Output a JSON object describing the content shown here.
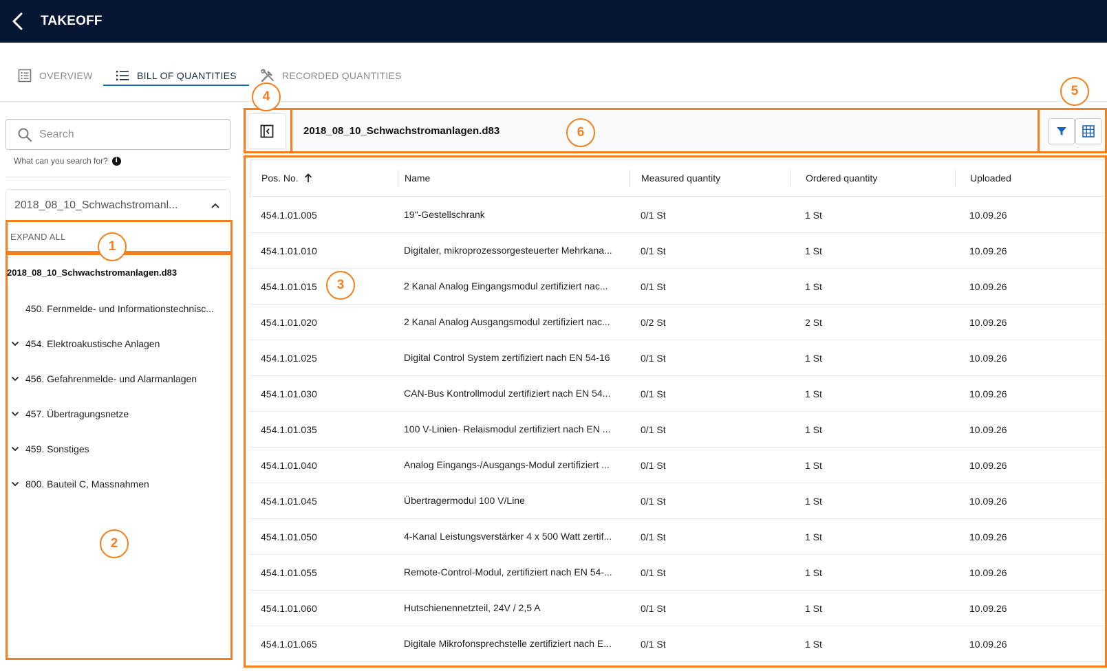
{
  "header": {
    "title": "TAKEOFF",
    "back_icon": "arrow-left-icon"
  },
  "tabs": [
    {
      "label": "OVERVIEW",
      "icon": "list-detail-icon",
      "active": false
    },
    {
      "label": "BILL OF QUANTITIES",
      "icon": "list-icon",
      "active": true
    },
    {
      "label": "RECORDED QUANTITIES",
      "icon": "tools-icon",
      "active": false
    }
  ],
  "sidebar": {
    "search_placeholder": "Search",
    "search_hint": "What can you search for?",
    "file_select": "2018_08_10_Schwachstromanl...",
    "expand_all": "EXPAND ALL",
    "tree_root": "2018_08_10_Schwachstromanlagen.d83",
    "tree_items": [
      {
        "label": "450. Fernmelde- und Informationstechnisc...",
        "expandable": false
      },
      {
        "label": "454. Elektroakustische Anlagen",
        "expandable": true
      },
      {
        "label": "456. Gefahrenmelde- und Alarmanlagen",
        "expandable": true
      },
      {
        "label": "457. Übertragungsnetze",
        "expandable": true
      },
      {
        "label": "459. Sonstiges",
        "expandable": true
      },
      {
        "label": "800. Bauteil C, Massnahmen",
        "expandable": true
      }
    ]
  },
  "toolbar": {
    "file_title": "2018_08_10_Schwachstromanlagen.d83"
  },
  "table": {
    "columns": [
      "Pos. No.",
      "Name",
      "Measured quantity",
      "Ordered quantity",
      "Uploaded"
    ],
    "sort_icon": "arrow-up-icon",
    "rows": [
      [
        "454.1.01.005",
        "19\"-Gestellschrank",
        "0/1 St",
        "1 St",
        "10.09.26"
      ],
      [
        "454.1.01.010",
        "Digitaler, mikroprozessorgesteuerter Mehrkana...",
        "0/1 St",
        "1 St",
        "10.09.26"
      ],
      [
        "454.1.01.015",
        "2 Kanal Analog Eingangsmodul zertifiziert nac...",
        "0/1 St",
        "1 St",
        "10.09.26"
      ],
      [
        "454.1.01.020",
        "2 Kanal Analog Ausgangsmodul zertifiziert nac...",
        "0/2 St",
        "2 St",
        "10.09.26"
      ],
      [
        "454.1.01.025",
        "Digital Control System zertifiziert nach EN 54-16",
        "0/1 St",
        "1 St",
        "10.09.26"
      ],
      [
        "454.1.01.030",
        "CAN-Bus Kontrollmodul zertifiziert nach EN 54...",
        "0/1 St",
        "1 St",
        "10.09.26"
      ],
      [
        "454.1.01.035",
        "100 V-Linien- Relaismodul zertifiziert nach EN ...",
        "0/1 St",
        "1 St",
        "10.09.26"
      ],
      [
        "454.1.01.040",
        "Analog Eingangs-/Ausgangs-Modul zertifiziert ...",
        "0/1 St",
        "1 St",
        "10.09.26"
      ],
      [
        "454.1.01.045",
        "Übertragermodul 100 V/Line",
        "0/1 St",
        "1 St",
        "10.09.26"
      ],
      [
        "454.1.01.050",
        "4-Kanal Leistungsverstärker 4 x 500 Watt zertif...",
        "0/1 St",
        "1 St",
        "10.09.26"
      ],
      [
        "454.1.01.055",
        "Remote-Control-Modul, zertifiziert nach EN 54-...",
        "0/1 St",
        "1 St",
        "10.09.26"
      ],
      [
        "454.1.01.060",
        "Hutschienennetzteil, 24V / 2,5 A",
        "0/1 St",
        "1 St",
        "10.09.26"
      ],
      [
        "454.1.01.065",
        "Digitale Mikrofonsprechstelle zertifiziert nach E...",
        "0/1 St",
        "1 St",
        "10.09.26"
      ]
    ]
  },
  "annotations": [
    "1",
    "2",
    "3",
    "4",
    "5",
    "6"
  ],
  "colors": {
    "header_bg": "#041631",
    "accent": "#1565c0",
    "annotation": "#f47f20"
  }
}
